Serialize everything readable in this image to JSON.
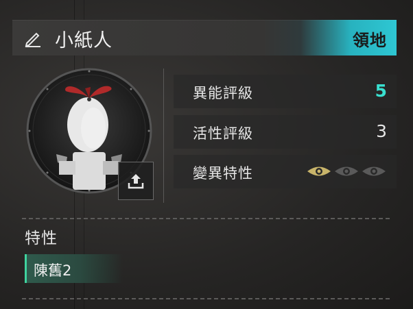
{
  "header": {
    "name": "小紙人",
    "badge": "領地",
    "edit_icon": "pencil-icon"
  },
  "portrait": {
    "upload_icon": "upload-icon"
  },
  "stats": [
    {
      "label": "異能評級",
      "value": "5",
      "highlight": true
    },
    {
      "label": "活性評級",
      "value": "3",
      "highlight": false
    },
    {
      "label": "變異特性",
      "eyes_active": 1,
      "eyes_total": 3
    }
  ],
  "traits": {
    "title": "特性",
    "items": [
      "陳舊2"
    ]
  },
  "colors": {
    "accent_cyan": "#2ec7d3",
    "value_highlight": "#39e0d0",
    "eye_active": "#c8b46a",
    "trait_green": "#3fd39f"
  }
}
